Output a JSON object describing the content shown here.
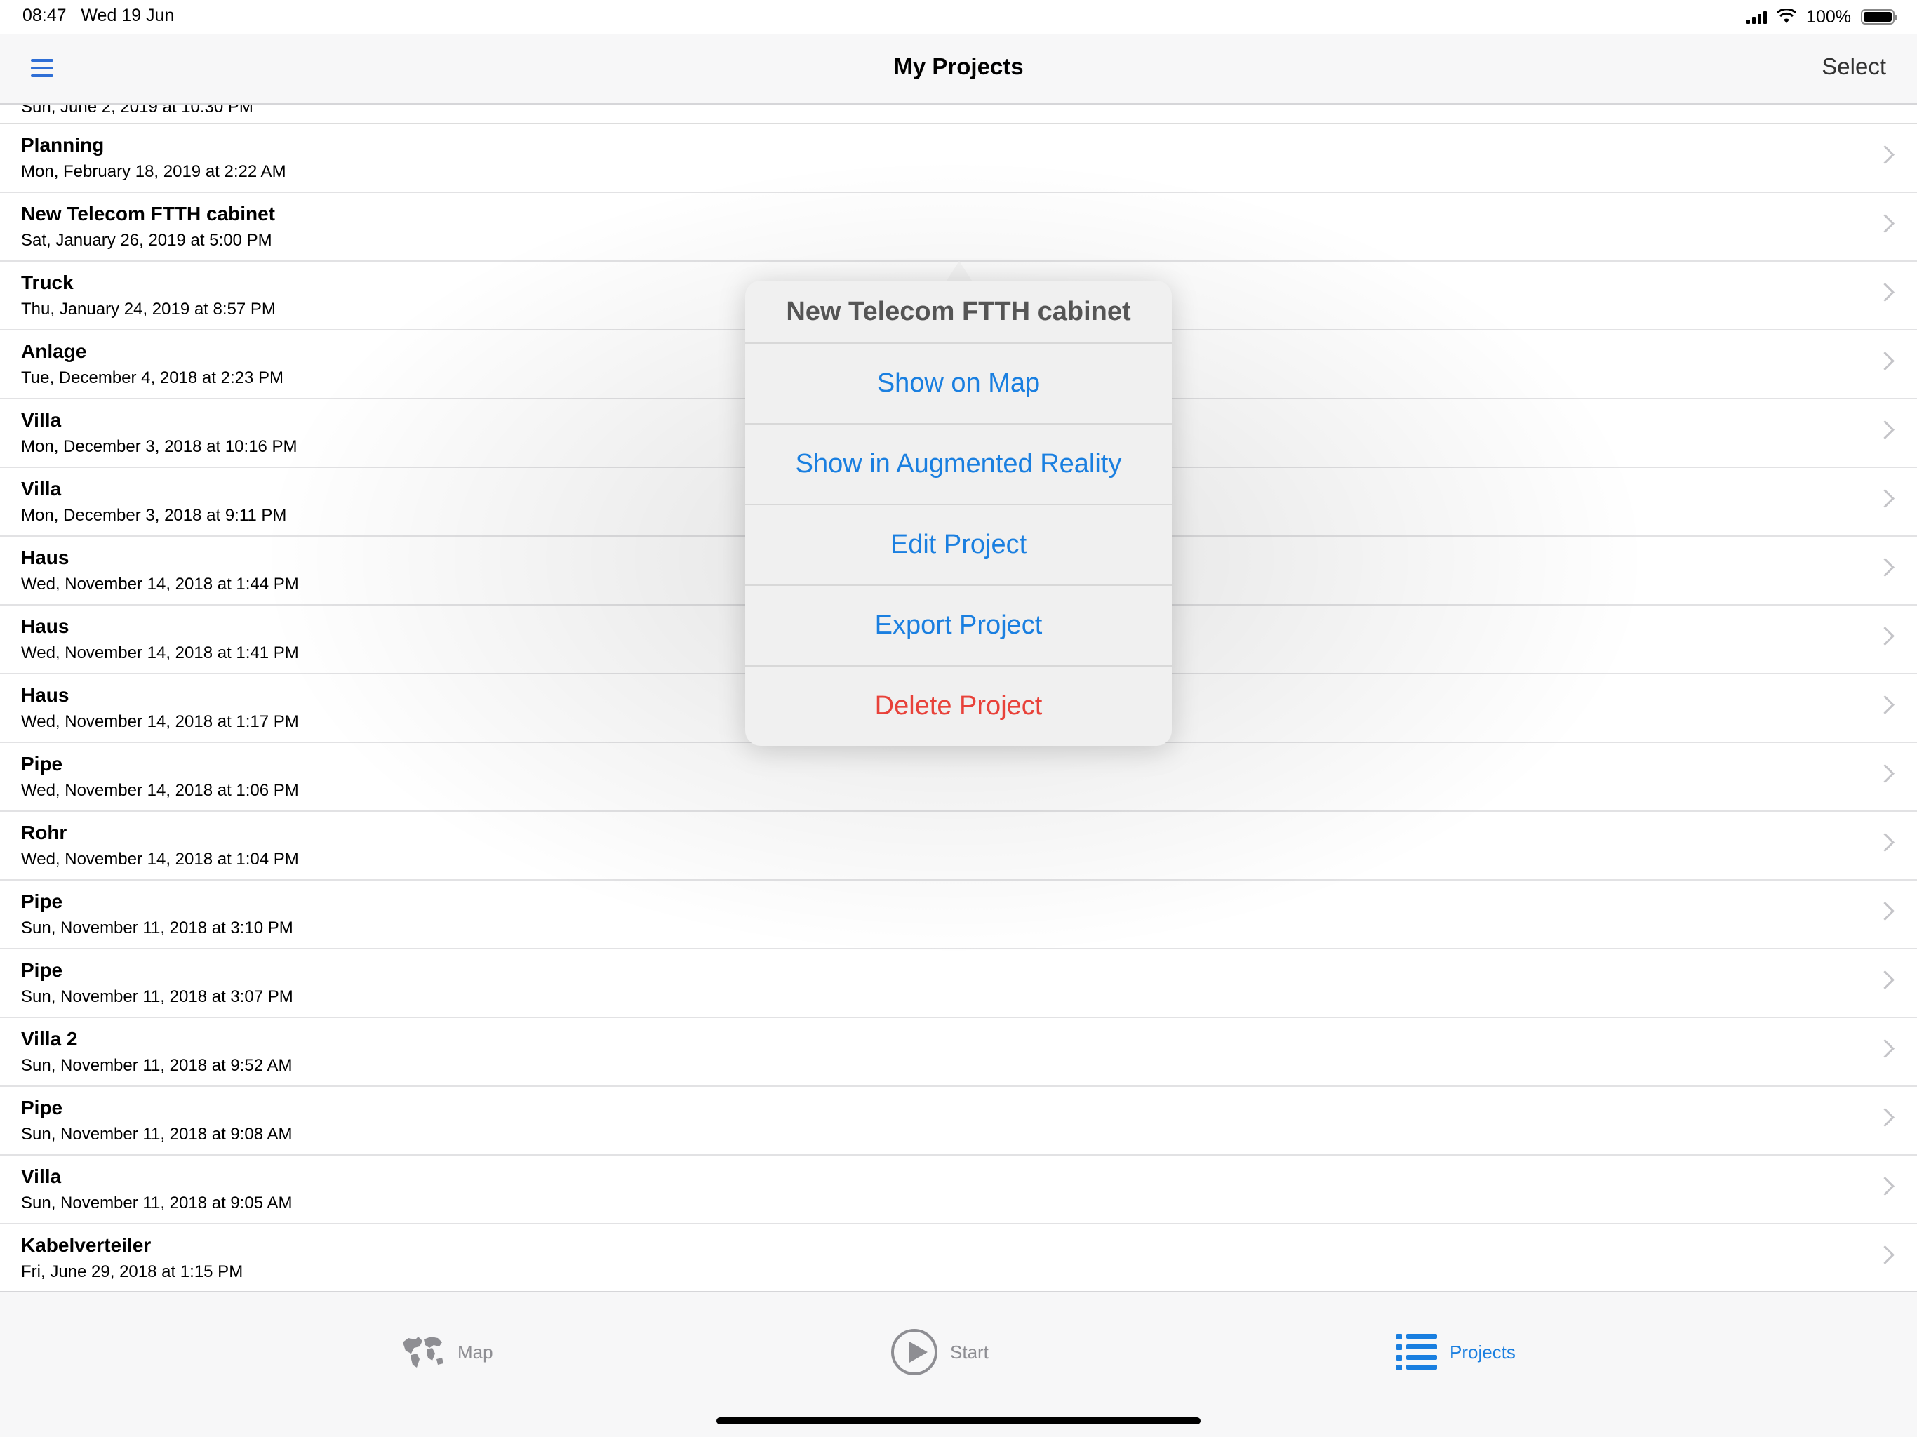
{
  "status_bar": {
    "time": "08:47",
    "date": "Wed 19 Jun",
    "battery": "100%"
  },
  "nav": {
    "title": "My Projects",
    "select_label": "Select"
  },
  "list": {
    "partial_row": "Sun, June 2, 2019 at 10:30 PM",
    "rows": [
      {
        "title": "Planning",
        "date": "Mon, February 18, 2019 at 2:22 AM"
      },
      {
        "title": "New Telecom FTTH cabinet",
        "date": "Sat, January 26, 2019 at 5:00 PM"
      },
      {
        "title": "Truck",
        "date": "Thu, January 24, 2019 at 8:57 PM"
      },
      {
        "title": "Anlage",
        "date": "Tue, December 4, 2018 at 2:23 PM"
      },
      {
        "title": "Villa",
        "date": "Mon, December 3, 2018 at 10:16 PM"
      },
      {
        "title": "Villa",
        "date": "Mon, December 3, 2018 at 9:11 PM"
      },
      {
        "title": "Haus",
        "date": "Wed, November 14, 2018 at 1:44 PM"
      },
      {
        "title": "Haus",
        "date": "Wed, November 14, 2018 at 1:41 PM"
      },
      {
        "title": "Haus",
        "date": "Wed, November 14, 2018 at 1:17 PM"
      },
      {
        "title": "Pipe",
        "date": "Wed, November 14, 2018 at 1:06 PM"
      },
      {
        "title": "Rohr",
        "date": "Wed, November 14, 2018 at 1:04 PM"
      },
      {
        "title": "Pipe",
        "date": "Sun, November 11, 2018 at 3:10 PM"
      },
      {
        "title": "Pipe",
        "date": "Sun, November 11, 2018 at 3:07 PM"
      },
      {
        "title": "Villa 2",
        "date": "Sun, November 11, 2018 at 9:52 AM"
      },
      {
        "title": "Pipe",
        "date": "Sun, November 11, 2018 at 9:08 AM"
      },
      {
        "title": "Villa",
        "date": "Sun, November 11, 2018 at 9:05 AM"
      },
      {
        "title": "Kabelverteiler",
        "date": "Fri, June 29, 2018 at 1:15 PM"
      }
    ]
  },
  "popover": {
    "title": "New Telecom FTTH cabinet",
    "actions": [
      {
        "label": "Show on Map",
        "name": "show-on-map-button"
      },
      {
        "label": "Show in Augmented Reality",
        "name": "show-in-ar-button"
      },
      {
        "label": "Edit Project",
        "name": "edit-project-button"
      },
      {
        "label": "Export Project",
        "name": "export-project-button"
      },
      {
        "label": "Delete Project",
        "name": "delete-project-button",
        "destructive": true
      }
    ]
  },
  "tabs": {
    "map": "Map",
    "start": "Start",
    "projects": "Projects",
    "active": "projects"
  },
  "icons": {
    "menu": "hamburger-icon",
    "map": "world-map-icon",
    "start": "play-circle-icon",
    "projects": "list-icon",
    "row_disclosure": "chevron-right-icon"
  },
  "colors": {
    "accent": "#1a7fe0",
    "destructive": "#e8423a"
  }
}
